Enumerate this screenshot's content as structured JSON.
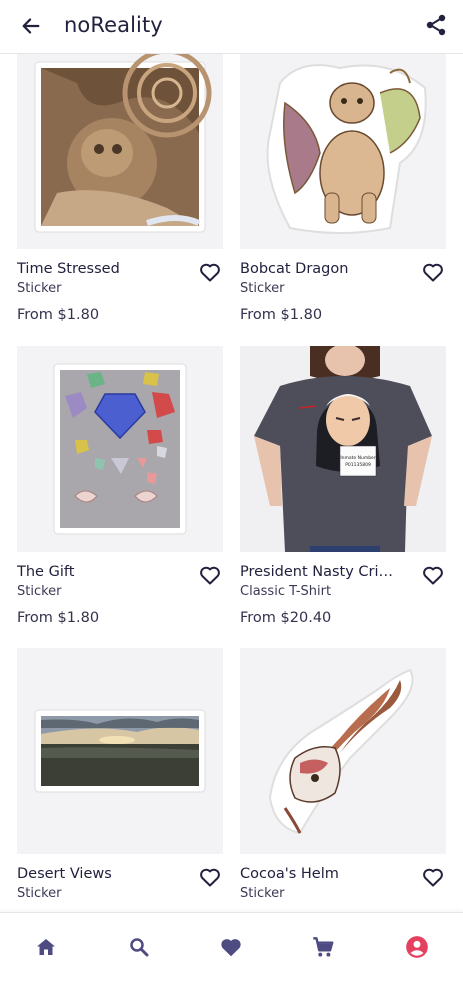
{
  "header": {
    "title": "noReality",
    "back_icon": "arrow-left-icon",
    "share_icon": "share-icon"
  },
  "products": [
    {
      "name": "Time Stressed",
      "type": "Sticker",
      "price": "From $1.80"
    },
    {
      "name": "Bobcat Dragon",
      "type": "Sticker",
      "price": "From $1.80"
    },
    {
      "name": "The Gift",
      "type": "Sticker",
      "price": "From $1.80"
    },
    {
      "name": "President Nasty Crimi...",
      "type": "Classic T-Shirt",
      "price": "From $20.40"
    },
    {
      "name": "Desert Views",
      "type": "Sticker",
      "price": ""
    },
    {
      "name": "Cocoa's Helm",
      "type": "Sticker",
      "price": ""
    }
  ],
  "tshirt_sign": {
    "line1": "Inmate Number",
    "line2": "P01135809"
  },
  "bottom_nav": [
    {
      "name": "home",
      "icon": "home-icon"
    },
    {
      "name": "search",
      "icon": "search-icon"
    },
    {
      "name": "favorites",
      "icon": "heart-icon"
    },
    {
      "name": "cart",
      "icon": "cart-icon"
    },
    {
      "name": "account",
      "icon": "account-icon",
      "active": true
    }
  ],
  "colors": {
    "nav_icon": "#4e4b82",
    "active": "#e4405f",
    "heart_outline": "#22213e",
    "card_bg": "#f3f3f5"
  }
}
